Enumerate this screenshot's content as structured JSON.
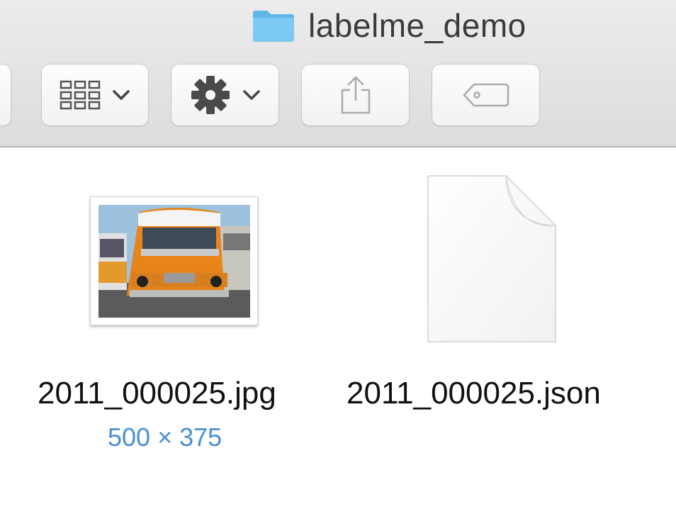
{
  "window": {
    "title": "labelme_demo",
    "folder_icon": "folder-icon",
    "accent_color": "#6cc0ef"
  },
  "toolbar": {
    "buttons": [
      {
        "name": "back",
        "icon": "chevron-left-icon"
      },
      {
        "name": "view-options",
        "icon": "grid-view-icon"
      },
      {
        "name": "action",
        "icon": "gear-icon"
      },
      {
        "name": "share",
        "icon": "share-icon"
      },
      {
        "name": "tags",
        "icon": "tag-icon"
      }
    ]
  },
  "files": [
    {
      "name": "2011_000025.jpg",
      "dimensions": "500 × 375",
      "icon": "image-thumbnail"
    },
    {
      "name": "2011_000025.json",
      "icon": "document-icon"
    }
  ],
  "colors": {
    "dimension_text": "#4a8fd4",
    "toolbar_bg": "#e4e4e4"
  }
}
